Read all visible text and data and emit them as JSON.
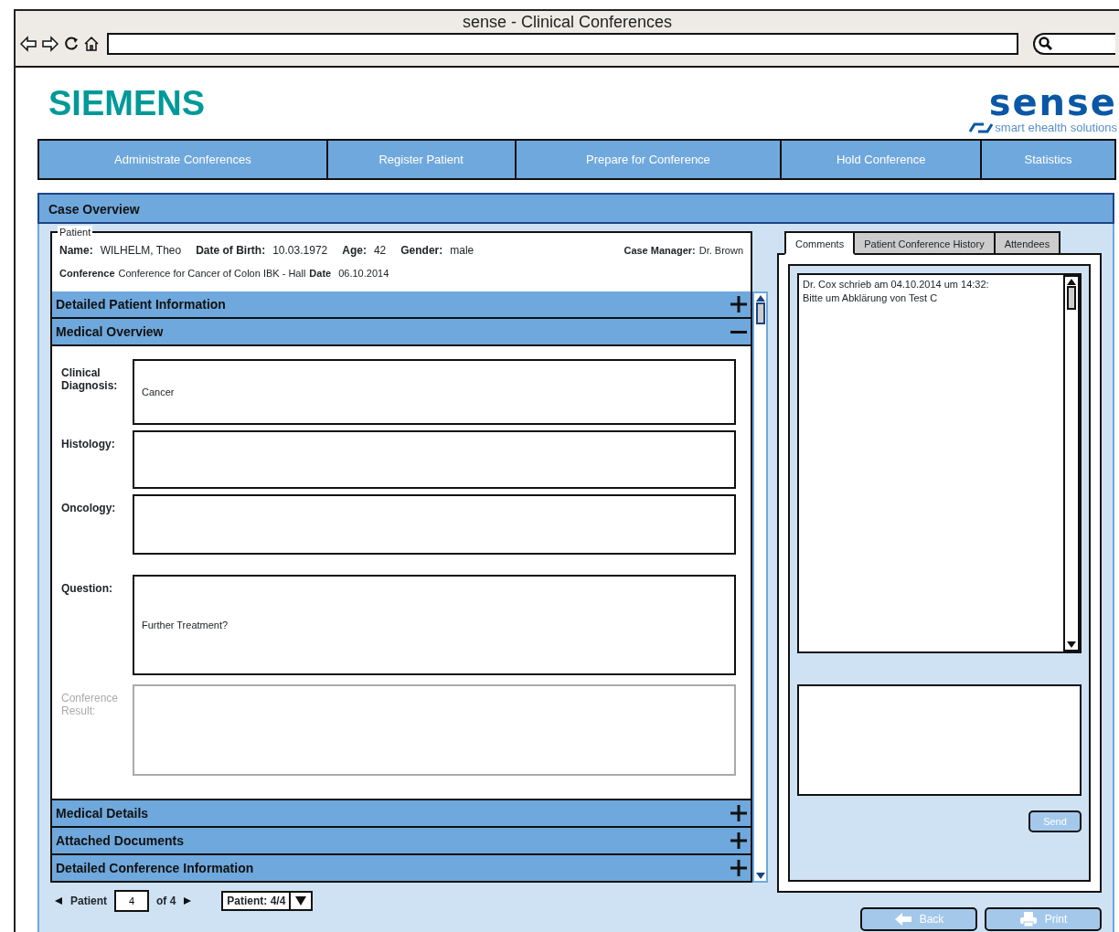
{
  "window": {
    "title": "sense - Clinical Conferences"
  },
  "header": {
    "left_logo": "SIEMENS",
    "right_logo": "sense",
    "right_logo_tagline": "smart ehealth solutions"
  },
  "nav": [
    {
      "label": "Administrate Conferences"
    },
    {
      "label": "Register Patient"
    },
    {
      "label": "Prepare for Conference"
    },
    {
      "label": "Hold Conference"
    },
    {
      "label": "Statistics"
    }
  ],
  "case_overview": {
    "title": "Case Overview"
  },
  "patient": {
    "legend": "Patient",
    "fields": [
      {
        "label": "Name:",
        "value": "WILHELM, Theo"
      },
      {
        "label": "Date of Birth:",
        "value": "10.03.1972"
      },
      {
        "label": "Age:",
        "value": "42"
      },
      {
        "label": "Gender:",
        "value": "male"
      }
    ],
    "case_manager_label": "Case Manager:",
    "case_manager": "Dr. Brown",
    "conference_label": "Conference",
    "conference": "Conference for Cancer of Colon IBK - Hall",
    "date_label": "Date",
    "date": "06.10.2014"
  },
  "sections": [
    {
      "title": "Detailed Patient Information",
      "expanded": false
    },
    {
      "title": "Medical Overview",
      "expanded": true,
      "fields": [
        {
          "label": "Clinical Diagnosis:",
          "value": "Cancer",
          "disabled": false
        },
        {
          "label": "Histology:",
          "disabled": false
        },
        {
          "label": "Oncology:",
          "disabled": false
        },
        {
          "label": "Question:",
          "value": "Further Treatment?",
          "disabled": false
        },
        {
          "label": "Conference Result:",
          "disabled": true
        }
      ]
    },
    {
      "title": "Medical Details",
      "expanded": false
    },
    {
      "title": "Attached Documents",
      "expanded": false
    },
    {
      "title": "Detailed Conference Information",
      "expanded": false
    }
  ],
  "pager": {
    "label": "Patient",
    "value": "4",
    "of": "of 4",
    "select": "Patient: 4/4"
  },
  "tabs": [
    {
      "label": "Comments",
      "selected": true
    },
    {
      "label": "Patient Conference History",
      "selected": false
    },
    {
      "label": "Attendees",
      "selected": false
    }
  ],
  "comments": [
    "Dr. Cox schrieb am 04.10.2014 um 14:32:",
    "Bitte um Abklärung von Test C"
  ],
  "buttons": {
    "send": "Send",
    "back": "Back",
    "print": "Print"
  }
}
